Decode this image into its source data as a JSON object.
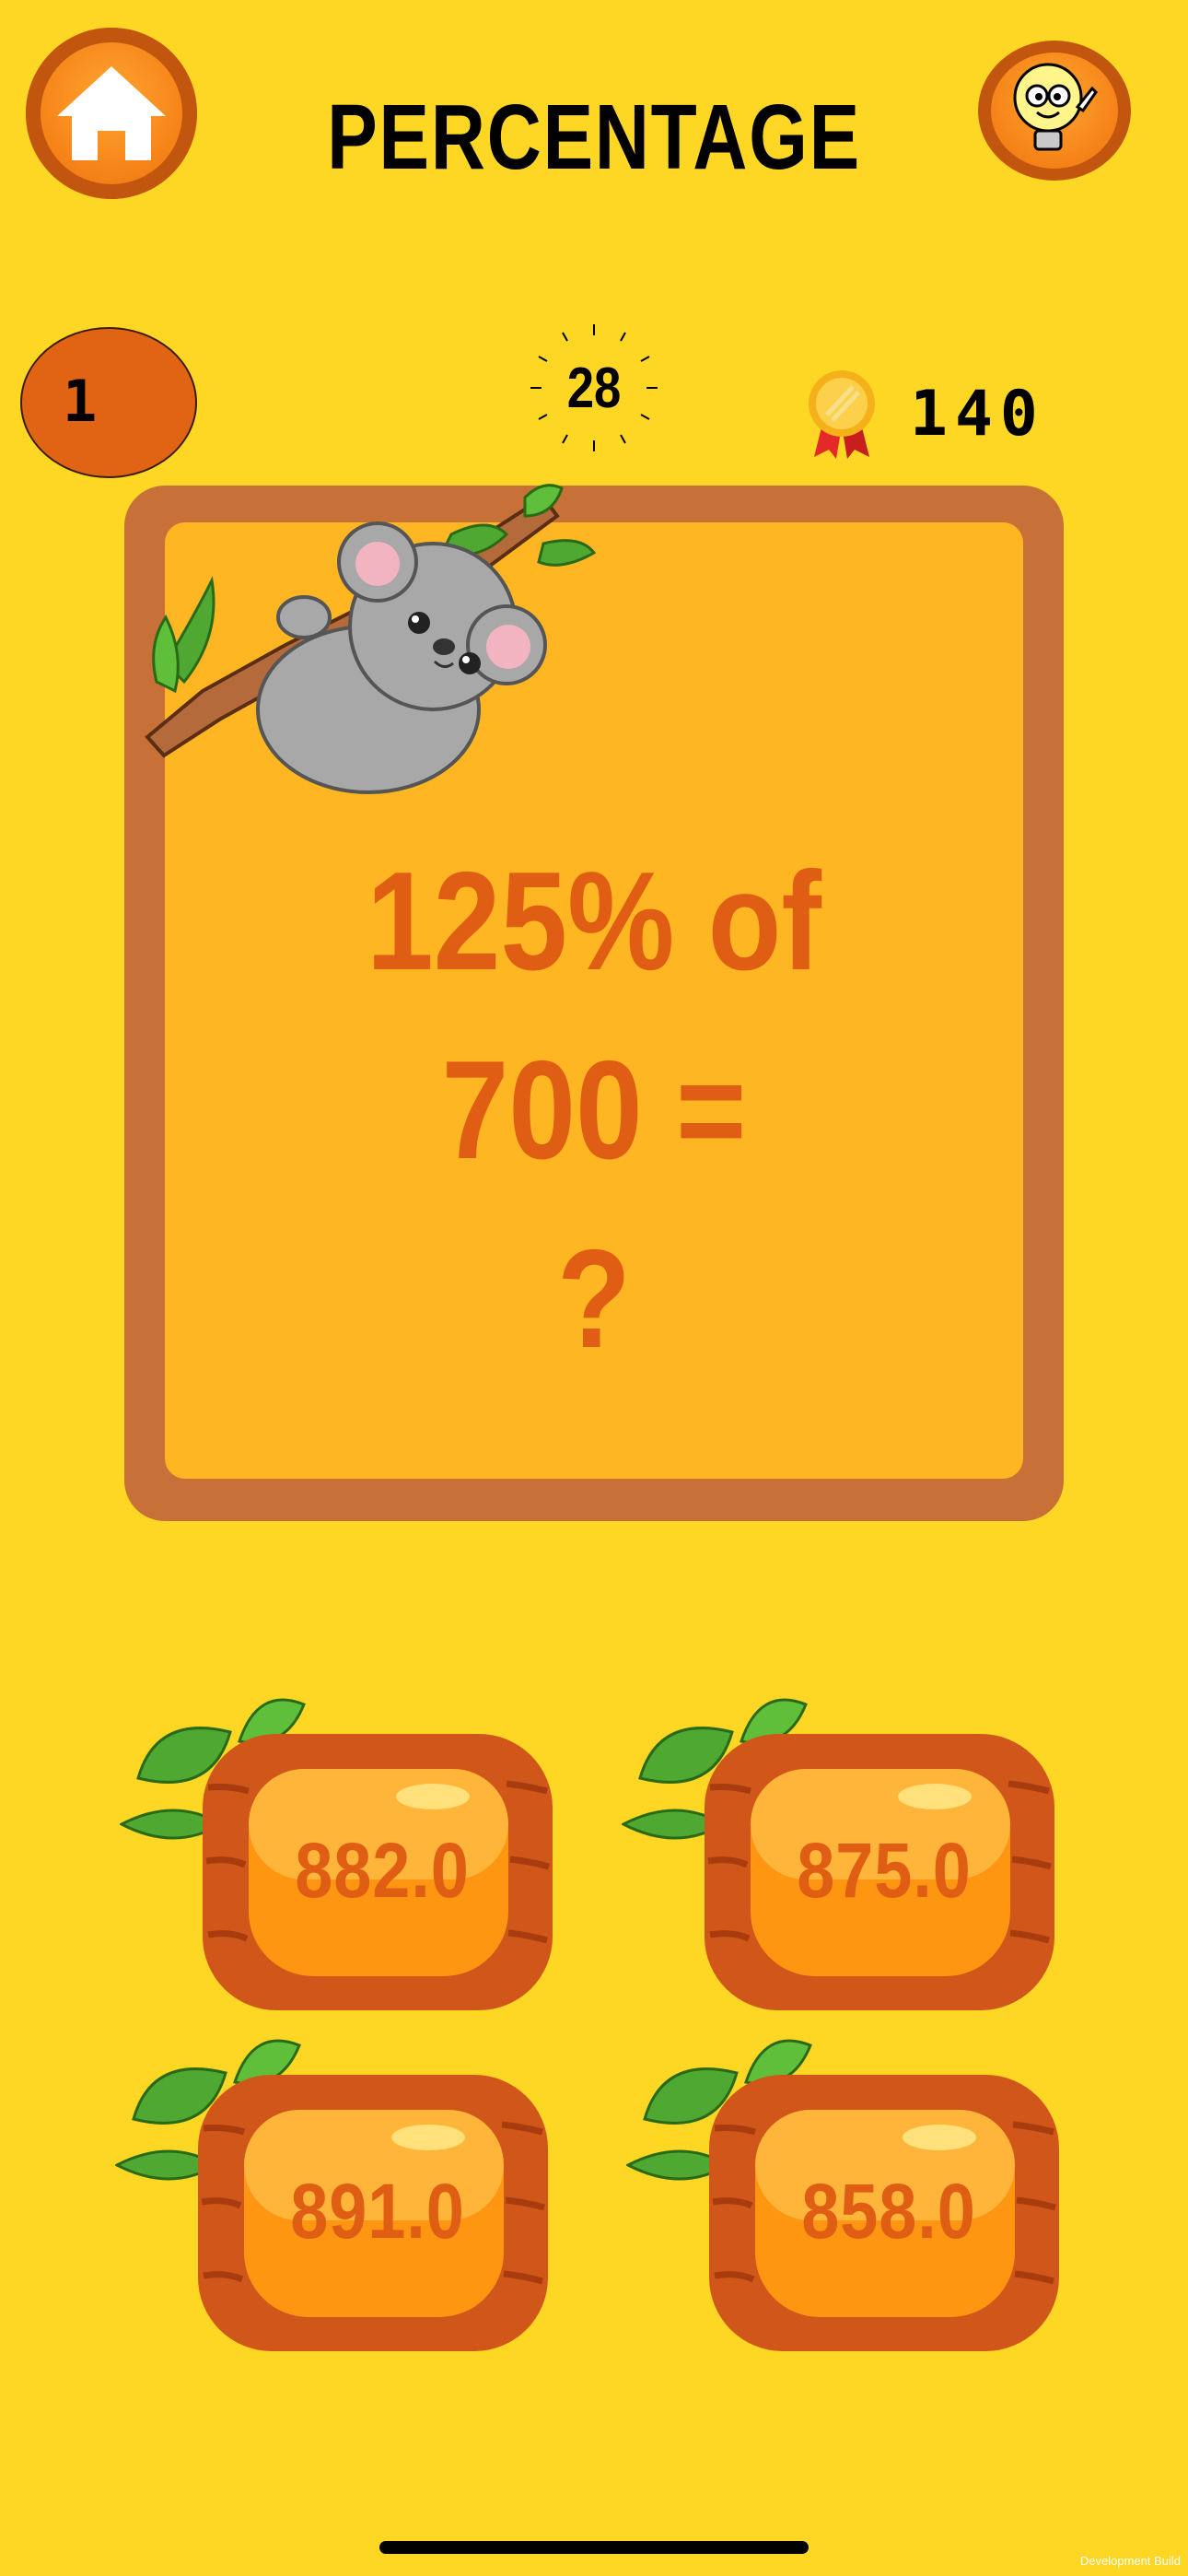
{
  "header": {
    "title": "PERCENTAGE",
    "home_icon": "home-icon",
    "hint_icon": "lightbulb-icon"
  },
  "status": {
    "level": "1",
    "timer": "28",
    "score": "140",
    "medal_icon": "medal-icon"
  },
  "question": {
    "line1": "125% of 700 =",
    "line2": "?"
  },
  "answers": [
    {
      "label": "882.0"
    },
    {
      "label": "875.0"
    },
    {
      "label": "891.0"
    },
    {
      "label": "858.0"
    }
  ],
  "footer": {
    "build_label": "Development Build"
  },
  "colors": {
    "background": "#fed624",
    "accent_orange": "#e05d14",
    "frame_brown": "#c77038",
    "panel_orange": "#ffb622"
  }
}
